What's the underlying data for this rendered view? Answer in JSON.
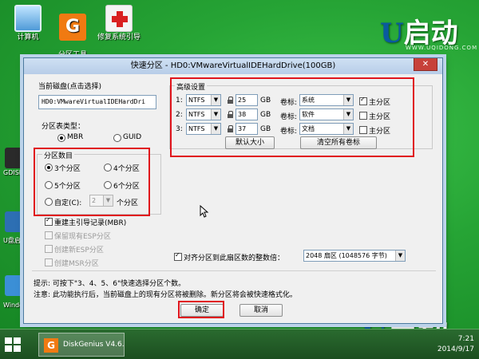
{
  "desktop": {
    "icons": [
      {
        "label": "计算机"
      },
      {
        "label": "分区工具\nDiskgenius"
      },
      {
        "label": "修复系统引导"
      }
    ],
    "side_labels": [
      "GDISK",
      "U盘启",
      "Windo"
    ]
  },
  "logo": {
    "brand": "启动",
    "letter": "U",
    "url": "WWW.UQIDONG.COM"
  },
  "dialog": {
    "title": "快速分区 - HD0:VMwareVirtualIDEHardDrive(100GB)",
    "close_label": "✕",
    "current_disk": {
      "title": "当前磁盘(点击选择)",
      "value": "HD0:VMwareVirtualIDEHardDri"
    },
    "partition_table": {
      "title": "分区表类型：",
      "options": [
        {
          "label": "MBR",
          "selected": true
        },
        {
          "label": "GUID",
          "selected": false
        }
      ]
    },
    "partition_count": {
      "title": "分区数目",
      "options": [
        {
          "label": "3个分区",
          "selected": true
        },
        {
          "label": "4个分区",
          "selected": false
        },
        {
          "label": "5个分区",
          "selected": false
        },
        {
          "label": "6个分区",
          "selected": false
        },
        {
          "label": "自定(C):",
          "selected": false
        }
      ],
      "custom_value": "2",
      "custom_suffix": "个分区"
    },
    "checkboxes": [
      {
        "label": "重建主引导记录(MBR)",
        "checked": true,
        "enabled": true
      },
      {
        "label": "保留现有ESP分区",
        "checked": false,
        "enabled": false
      },
      {
        "label": "创建新ESP分区",
        "checked": false,
        "enabled": false
      },
      {
        "label": "创建MSR分区",
        "checked": false,
        "enabled": false
      }
    ],
    "advanced": {
      "title": "高级设置",
      "volume_label_text": "卷标:",
      "primary_label": "主分区",
      "rows": [
        {
          "index": "1:",
          "fs": "NTFS",
          "size": "25",
          "unit": "GB",
          "volume": "系统",
          "primary": true
        },
        {
          "index": "2:",
          "fs": "NTFS",
          "size": "38",
          "unit": "GB",
          "volume": "软件",
          "primary": false
        },
        {
          "index": "3:",
          "fs": "NTFS",
          "size": "37",
          "unit": "GB",
          "volume": "文档",
          "primary": false
        }
      ],
      "default_size_button": "默认大小",
      "clear_labels_button": "清空所有卷标"
    },
    "align": {
      "label": "对齐分区到此扇区数的整数倍：",
      "checked": true,
      "value": "2048 扇区 (1048576 字节)"
    },
    "hint_line1": "提示: 可按下\"3、4、5、6\"快速选择分区个数。",
    "hint_line2": "注意: 此功能执行后，当前磁盘上的现有分区将被删除。新分区将会被快速格式化。",
    "ok_button": "确定",
    "cancel_button": "取消"
  },
  "taskbar": {
    "task_label": "DiskGenius V4.6...",
    "time": "7:21",
    "date": "2014/9/17"
  },
  "colors": {
    "highlight": "#e0141c",
    "desktop_green": "#26a435",
    "brand_orange": "#f07a12"
  }
}
